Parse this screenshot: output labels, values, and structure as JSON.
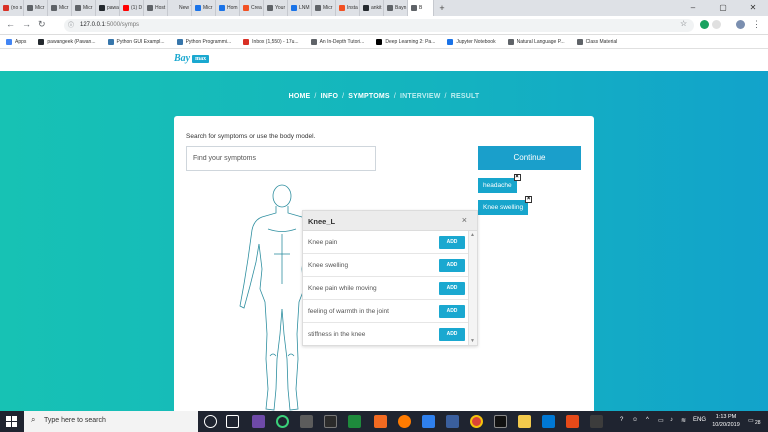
{
  "browser": {
    "tabs": [
      {
        "label": "(no s",
        "color": "#d93025"
      },
      {
        "label": "Micr",
        "color": "#5f6368"
      },
      {
        "label": "Micr",
        "color": "#5f6368"
      },
      {
        "label": "Micr",
        "color": "#5f6368"
      },
      {
        "label": "pawa",
        "color": "#24292e"
      },
      {
        "label": "(1) D",
        "color": "#ff0000"
      },
      {
        "label": "Host",
        "color": "#5f6368"
      },
      {
        "label": "New Tab",
        "color": "#dee1e6"
      },
      {
        "label": "Micr",
        "color": "#1a73e8"
      },
      {
        "label": "Hom",
        "color": "#1a73e8"
      },
      {
        "label": "Crea",
        "color": "#f25022"
      },
      {
        "label": "Your",
        "color": "#5f6368"
      },
      {
        "label": "LNM",
        "color": "#1a73e8"
      },
      {
        "label": "Micr",
        "color": "#5f6368"
      },
      {
        "label": "Insta",
        "color": "#f25022"
      },
      {
        "label": "ankit",
        "color": "#24292e"
      },
      {
        "label": "Bayn",
        "color": "#5f6368"
      },
      {
        "label": "B",
        "color": "#5f6368"
      }
    ],
    "url_host": "127.0.0.1",
    "url_path": ":5000/symps",
    "bookmarks": [
      {
        "label": "Apps",
        "color": "#4285f4"
      },
      {
        "label": "pawangeek (Pawan...",
        "color": "#24292e"
      },
      {
        "label": "Python GUI Exampl...",
        "color": "#3776ab"
      },
      {
        "label": "Python Programmi...",
        "color": "#3776ab"
      },
      {
        "label": "Inbox (1,550) - 17u...",
        "color": "#d93025"
      },
      {
        "label": "An In-Depth Tutori...",
        "color": "#5f6368"
      },
      {
        "label": "Deep Learning 2: Pa...",
        "color": "#000000"
      },
      {
        "label": "Jupyter Notebook",
        "color": "#1a73e8"
      },
      {
        "label": "Natural Language P...",
        "color": "#5f6368"
      },
      {
        "label": "Class Material",
        "color": "#5f6368"
      }
    ]
  },
  "header": {
    "logo_bay": "Bay",
    "logo_max": "max"
  },
  "steps": {
    "home": "HOME",
    "info": "INFO",
    "symptoms": "SYMPTOMS",
    "interview": "INTERVIEW",
    "result": "RESULT",
    "separator": "/"
  },
  "main": {
    "intro": "Search for symptoms or use the body model.",
    "search_placeholder": "Find your symptoms",
    "continue_label": "Continue",
    "selected": [
      {
        "label": "headache"
      },
      {
        "label": "Knee swelling"
      }
    ],
    "chip_close": "×"
  },
  "popup": {
    "title": "Knee_L",
    "close": "×",
    "add_label": "ADD",
    "items": [
      {
        "label": "Knee pain"
      },
      {
        "label": "Knee swelling"
      },
      {
        "label": "Knee pain while moving"
      },
      {
        "label": "feeling of warmth in the joint"
      },
      {
        "label": "stiffness in the knee"
      }
    ]
  },
  "taskbar": {
    "search_placeholder": "Type here to search",
    "language": "ENG",
    "time": "1:13 PM",
    "date": "10/20/2019",
    "notification_count": "28"
  },
  "colors": {
    "accent": "#1aa8d0",
    "gradient_start": "#17c2b4",
    "gradient_end": "#12a3cb"
  }
}
